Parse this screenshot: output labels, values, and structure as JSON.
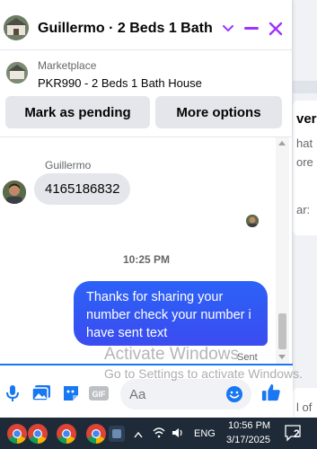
{
  "header": {
    "title": "Guillermo · 2 Beds 1 Bath ...",
    "accent": "#a033ff"
  },
  "marketplace": {
    "label": "Marketplace",
    "listing": "PKR990 - 2 Beds 1 Bath House"
  },
  "actions": {
    "mark_pending": "Mark as pending",
    "more_options": "More options"
  },
  "conversation": {
    "sender_name": "Guillermo",
    "incoming_message": "4165186832",
    "timestamp": "10:25 PM",
    "outgoing_message": "Thanks for sharing your number check your number i have sent text",
    "status": "Sent"
  },
  "composer": {
    "placeholder": "Aa"
  },
  "watermark": {
    "line1": "Activate Windows",
    "line2": "Go to Settings to activate Windows."
  },
  "background_page": {
    "heading": "vers",
    "line1": "hat",
    "line2": "ore",
    "line3": "ar:",
    "line4": "l of"
  },
  "taskbar": {
    "language": "ENG",
    "time": "10:56 PM",
    "date": "3/17/2025",
    "notification_count": "2"
  },
  "colors": {
    "outgoing_bubble": "#2c5ff6",
    "messenger_blue": "#1877f2",
    "taskbar": "#1f2a38"
  }
}
